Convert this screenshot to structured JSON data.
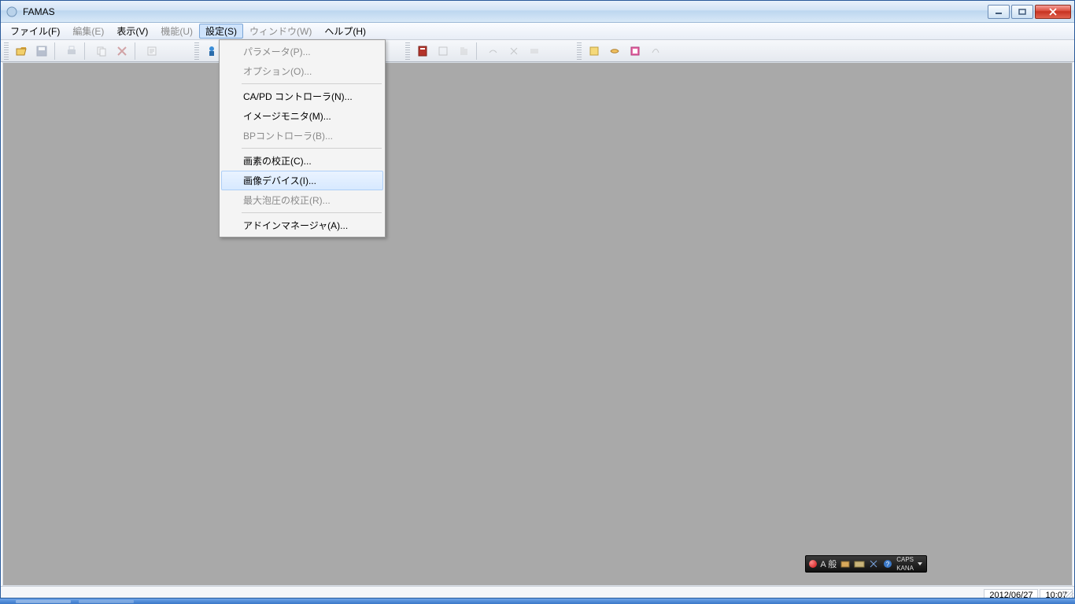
{
  "titlebar": {
    "title": "FAMAS"
  },
  "menu": {
    "items": [
      {
        "label": "ファイル(F)",
        "disabled": false
      },
      {
        "label": "編集(E)",
        "disabled": true
      },
      {
        "label": "表示(V)",
        "disabled": false
      },
      {
        "label": "機能(U)",
        "disabled": true
      },
      {
        "label": "設定(S)",
        "disabled": false,
        "active": true
      },
      {
        "label": "ウィンドウ(W)",
        "disabled": true
      },
      {
        "label": "ヘルプ(H)",
        "disabled": false
      }
    ]
  },
  "dropdown": {
    "items": [
      {
        "label": "パラメータ(P)...",
        "disabled": true
      },
      {
        "label": "オプション(O)...",
        "disabled": true
      },
      {
        "sep": true
      },
      {
        "label": "CA/PD コントローラ(N)...",
        "disabled": false
      },
      {
        "label": "イメージモニタ(M)...",
        "disabled": false
      },
      {
        "label": "BPコントローラ(B)...",
        "disabled": true
      },
      {
        "sep": true
      },
      {
        "label": "画素の校正(C)...",
        "disabled": false
      },
      {
        "label": "画像デバイス(I)...",
        "disabled": false,
        "hover": true
      },
      {
        "label": "最大泡圧の校正(R)...",
        "disabled": true
      },
      {
        "sep": true
      },
      {
        "label": "アドインマネージャ(A)...",
        "disabled": false
      }
    ]
  },
  "status": {
    "date": "2012/06/27",
    "time": "10:07"
  },
  "ime": {
    "mode": "A 般",
    "caps": "CAPS",
    "kana": "KANA"
  }
}
